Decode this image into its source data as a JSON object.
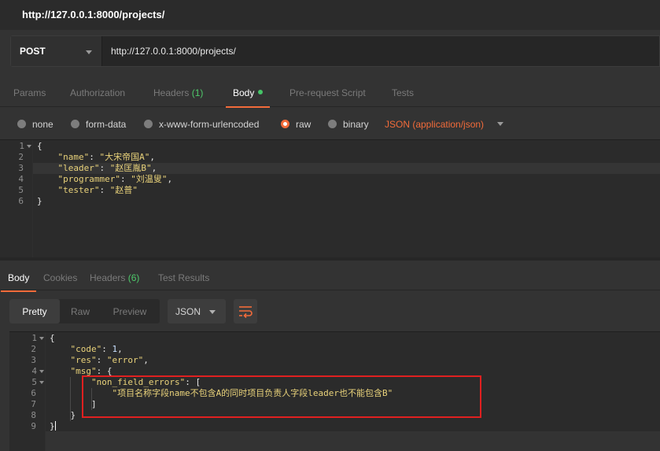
{
  "window": {
    "title": "http://127.0.0.1:8000/projects/"
  },
  "request": {
    "method": "POST",
    "url": "http://127.0.0.1:8000/projects/"
  },
  "request_tabs": [
    {
      "label": "Params"
    },
    {
      "label": "Authorization"
    },
    {
      "label": "Headers",
      "count": "(1)"
    },
    {
      "label": "Body"
    },
    {
      "label": "Pre-request Script"
    },
    {
      "label": "Tests"
    }
  ],
  "body_types": [
    "none",
    "form-data",
    "x-www-form-urlencoded",
    "raw",
    "binary"
  ],
  "content_type": "JSON (application/json)",
  "request_body": {
    "line_numbers": [
      "1",
      "2",
      "3",
      "4",
      "5",
      "6"
    ],
    "open": "{",
    "close": "}",
    "fields": [
      {
        "key": "\"name\"",
        "value": "\"大宋帝国A\"",
        "trail": ","
      },
      {
        "key": "\"leader\"",
        "value": "\"赵匡胤B\"",
        "trail": ","
      },
      {
        "key": "\"programmer\"",
        "value": "\"刘温叟\"",
        "trail": ","
      },
      {
        "key": "\"tester\"",
        "value": "\"赵普\"",
        "trail": ""
      }
    ]
  },
  "response_tabs": [
    {
      "label": "Body"
    },
    {
      "label": "Cookies"
    },
    {
      "label": "Headers",
      "count": "(6)"
    },
    {
      "label": "Test Results"
    }
  ],
  "response_view": {
    "modes": [
      "Pretty",
      "Raw",
      "Preview"
    ],
    "format": "JSON"
  },
  "response_body": {
    "line_numbers": [
      "1",
      "2",
      "3",
      "4",
      "5",
      "6",
      "7",
      "8",
      "9"
    ],
    "open": "{",
    "code_key": "\"code\"",
    "code_value": "1",
    "res_key": "\"res\"",
    "res_value": "\"error\"",
    "msg_key": "\"msg\"",
    "nfe_key": "\"non_field_errors\"",
    "nfe_message": "\"项目名称字段name不包含A的同时项目负责人字段leader也不能包含B\"",
    "close_array": "]",
    "close_msg": "}",
    "close": "}"
  }
}
